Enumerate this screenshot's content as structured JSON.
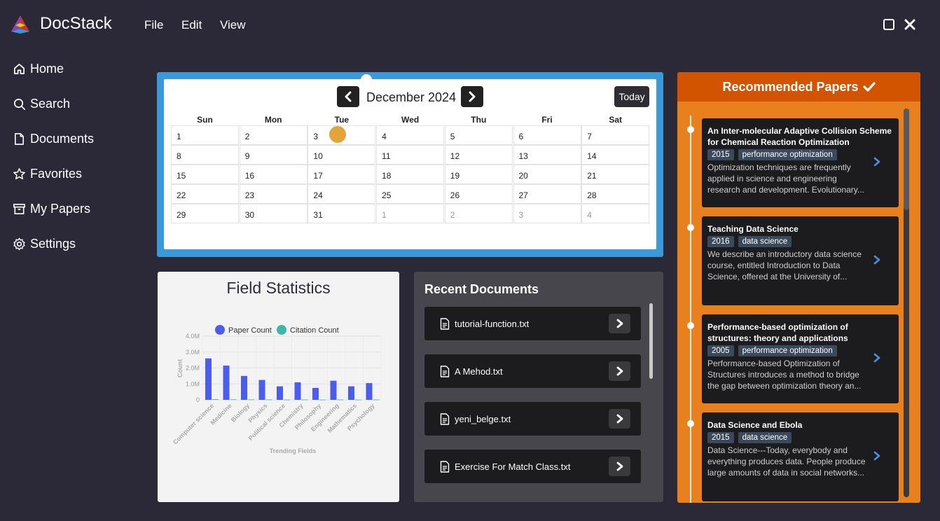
{
  "app": {
    "title": "DocStack",
    "menu": [
      "File",
      "Edit",
      "View"
    ]
  },
  "sidebar": {
    "items": [
      {
        "label": "Home",
        "icon": "home-icon"
      },
      {
        "label": "Search",
        "icon": "search-icon"
      },
      {
        "label": "Documents",
        "icon": "document-icon"
      },
      {
        "label": "Favorites",
        "icon": "star-icon"
      },
      {
        "label": "My Papers",
        "icon": "archive-icon"
      },
      {
        "label": "Settings",
        "icon": "gear-icon"
      }
    ]
  },
  "calendar": {
    "month_label": "December 2024",
    "today_label": "Today",
    "weekdays": [
      "Sun",
      "Mon",
      "Tue",
      "Wed",
      "Thu",
      "Fri",
      "Sat"
    ],
    "weeks": [
      [
        "1",
        "2",
        "3",
        "4",
        "5",
        "6",
        "7"
      ],
      [
        "8",
        "9",
        "10",
        "11",
        "12",
        "13",
        "14"
      ],
      [
        "15",
        "16",
        "17",
        "18",
        "19",
        "20",
        "21"
      ],
      [
        "22",
        "23",
        "24",
        "25",
        "26",
        "27",
        "28"
      ],
      [
        "29",
        "30",
        "31",
        "1",
        "2",
        "3",
        "4"
      ]
    ],
    "event_day": "3",
    "colors": {
      "frame": "#3a9ad9",
      "event": "#e3a43c"
    }
  },
  "stats": {
    "title": "Field Statistics",
    "chart_data": {
      "type": "bar",
      "title": "",
      "xlabel": "Trending Fields",
      "ylabel": "Count",
      "ylim": [
        0,
        4000000
      ],
      "yticks": [
        "0",
        "1.0M",
        "2.0M",
        "3.0M",
        "4.0M"
      ],
      "categories": [
        "Computer science",
        "Medicine",
        "Biology",
        "Physics",
        "Political science",
        "Chemistry",
        "Philosophy",
        "Engineering",
        "Mathematics",
        "Psychology"
      ],
      "series": [
        {
          "name": "Paper Count",
          "color": "#4c5cec",
          "values": [
            2600000,
            2150000,
            1500000,
            1250000,
            850000,
            1100000,
            750000,
            1200000,
            850000,
            1050000
          ]
        },
        {
          "name": "Citation Count",
          "color": "#3fb6a8",
          "values": [
            40000,
            30000,
            25000,
            20000,
            15000,
            20000,
            12000,
            20000,
            15000,
            18000
          ]
        }
      ],
      "legend": "top"
    }
  },
  "recent": {
    "title": "Recent Documents",
    "items": [
      "tutorial-function.txt",
      "A Mehod.txt",
      "yeni_belge.txt",
      "Exercise For Match Class.txt"
    ]
  },
  "recommended": {
    "title": "Recommended Papers",
    "papers": [
      {
        "title": "An Inter-molecular Adaptive Collision Scheme for Chemical Reaction Optimization",
        "year": "2015",
        "tag": "performance optimization",
        "abstract": "Optimization techniques are frequently applied in science and engineering research and development. Evolutionary..."
      },
      {
        "title": "Teaching Data Science",
        "year": "2016",
        "tag": "data science",
        "abstract": "We describe an introductory data science course, entitled Introduction to Data Science, offered at the University of..."
      },
      {
        "title": "Performance-based optimization of structures: theory and applications",
        "year": "2005",
        "tag": "performance optimization",
        "abstract": "Performance-based Optimization of Structures introduces a method to bridge the gap between optimization theory an..."
      },
      {
        "title": "Data Science and Ebola",
        "year": "2015",
        "tag": "data science",
        "abstract": "Data Science---Today, everybody and everything produces data. People produce large amounts of data in social networks..."
      }
    ]
  }
}
